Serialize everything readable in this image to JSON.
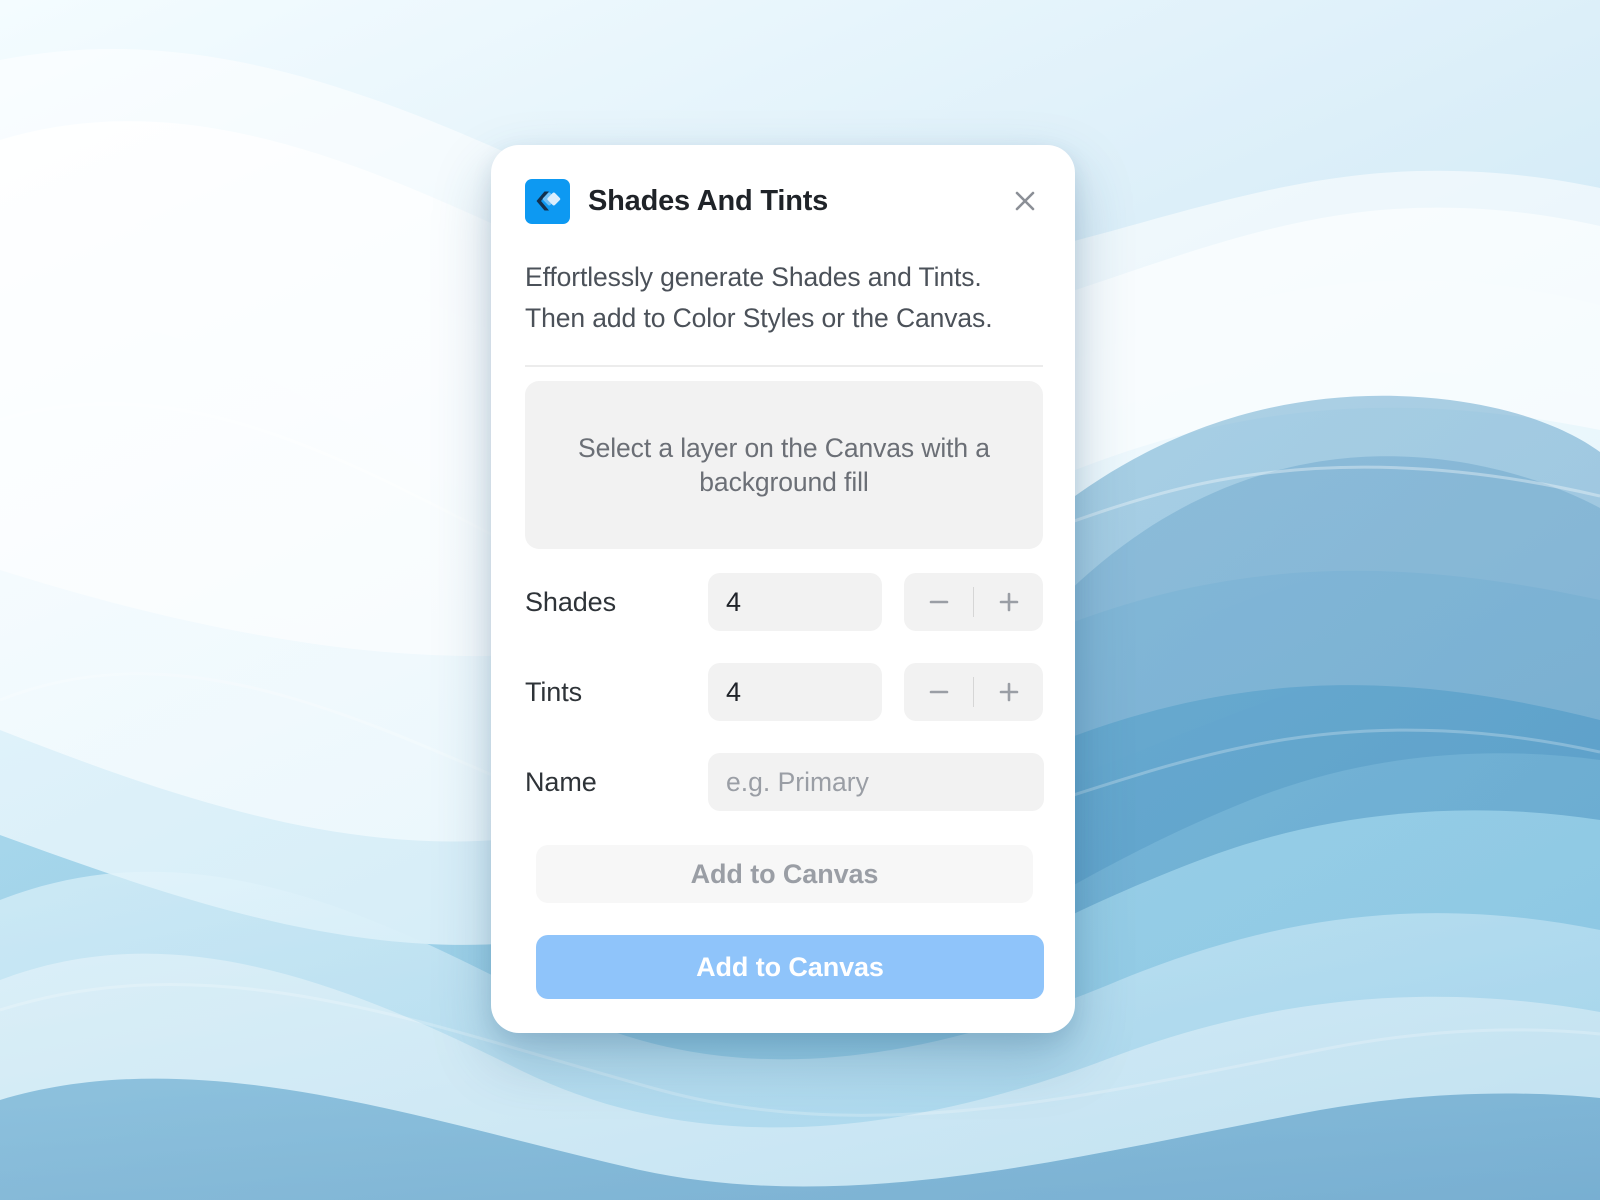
{
  "background": {
    "name": "abstract-blue-waves",
    "colors": {
      "lightest": "#f2fbff",
      "light": "#d7eef9",
      "mid": "#8fcbe5",
      "deep": "#4d9fcd",
      "deepest": "#3c87bb"
    }
  },
  "modal": {
    "header": {
      "icon_name": "shades-and-tints-logo",
      "title": "Shades And Tints",
      "close_label": "×"
    },
    "description": "Effortlessly generate Shades and Tints. Then add to Color Styles or the Canvas.",
    "notice": "Select a layer on the Canvas with a background fill",
    "fields": [
      {
        "key": "shades",
        "label": "Shades",
        "value": "4",
        "stepper": {
          "decrement": "−",
          "increment": "+"
        }
      },
      {
        "key": "tints",
        "label": "Tints",
        "value": "4",
        "stepper": {
          "decrement": "−",
          "increment": "+"
        }
      }
    ],
    "name_field": {
      "label": "Name",
      "value": "",
      "placeholder": "e.g. Primary"
    },
    "actions": {
      "secondary_label": "Add to Canvas",
      "primary_label": "Add to Canvas"
    },
    "colors": {
      "accent": "#0d99f2",
      "primary_button": "#8fc4fa",
      "field_background": "#f2f2f2",
      "card_background": "#ffffff"
    }
  }
}
